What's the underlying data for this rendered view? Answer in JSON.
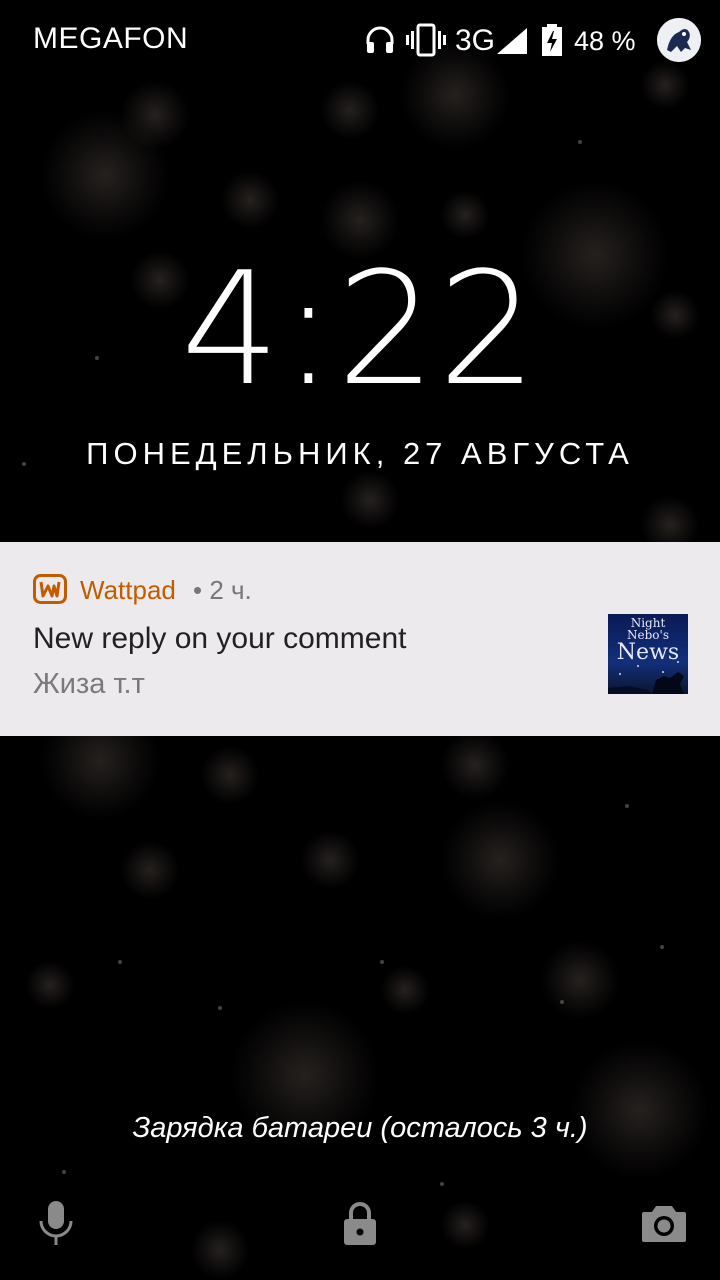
{
  "status_bar": {
    "carrier": "MEGAFON",
    "network": "3G",
    "battery_percent": "48 %",
    "icons": [
      "headphones-icon",
      "vibrate-icon",
      "signal-icon",
      "battery-charging-icon"
    ]
  },
  "lockscreen": {
    "time": "4:22",
    "date": "ПОНЕДЕЛЬНИК, 27 АВГУСТА",
    "charging_status": "Зарядка батареи (осталось 3 ч.)"
  },
  "notification": {
    "app_name": "Wattpad",
    "time_ago": "• 2 ч.",
    "title": "New reply on your comment",
    "text": "Жиза т.т",
    "app_icon": "wattpad-icon",
    "thumbnail_lines": [
      "Night",
      "Nebo's",
      "News"
    ],
    "accent_color": "#c25c00",
    "background_color": "#eceaec"
  },
  "bottom_actions": {
    "left": "mic-icon",
    "center": "lock-icon",
    "right": "camera-icon"
  }
}
